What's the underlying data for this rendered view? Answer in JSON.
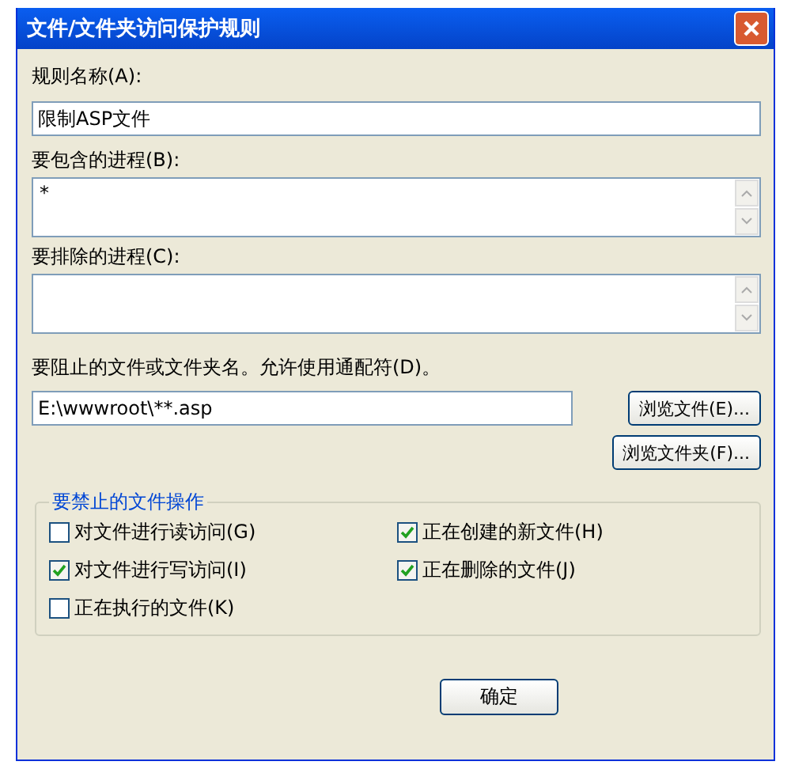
{
  "window": {
    "title": "文件/文件夹访问保护规则"
  },
  "rule_name": {
    "label": "规则名称(A):",
    "value": "限制ASP文件"
  },
  "include_processes": {
    "label": "要包含的进程(B):",
    "value": "*"
  },
  "exclude_processes": {
    "label": "要排除的进程(C):"
  },
  "blocked_path": {
    "label": "要阻止的文件或文件夹名。允许使用通配符(D)。",
    "value": "E:\\wwwroot\\**.asp"
  },
  "browse_buttons": [
    "浏览文件(E)...",
    "浏览文件夹(F)..."
  ],
  "operations": {
    "title": "要禁止的文件操作",
    "items": [
      {
        "label": "对文件进行读访问(G)",
        "checked": false
      },
      {
        "label": "正在创建的新文件(H)",
        "checked": true
      },
      {
        "label": "对文件进行写访问(I)",
        "checked": true
      },
      {
        "label": "正在删除的文件(J)",
        "checked": true
      },
      {
        "label": "正在执行的文件(K)",
        "checked": false
      }
    ]
  },
  "buttons": [
    "确定"
  ]
}
